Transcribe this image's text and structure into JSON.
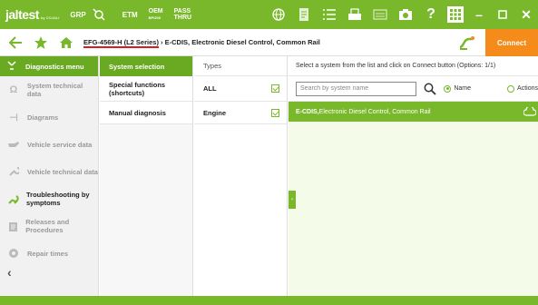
{
  "topbar": {
    "logo": "jaltest",
    "logo_sub": "by COJALI",
    "grp": "GRP",
    "etm": "ETM",
    "oem_line1": "OEM",
    "oem_line2": "BPI200",
    "pass_line1": "PASS",
    "pass_line2": "THRU"
  },
  "navbar": {
    "vehicle_id": "EFG-4569-H (L2 Series)",
    "system": " › E-CDIS, Electronic Diesel Control, Common Rail",
    "connect_label": "Connect"
  },
  "leftmenu": {
    "title": "Diagnostics menu",
    "items": [
      {
        "label": "System technical data"
      },
      {
        "label": "Diagrams"
      },
      {
        "label": "Vehicle service data"
      },
      {
        "label": "Vehicle technical data"
      },
      {
        "label": "Troubleshooting by symptoms"
      },
      {
        "label": "Releases and Procedures"
      },
      {
        "label": "Repair times"
      }
    ]
  },
  "system_selection": {
    "title": "System selection",
    "rows": [
      {
        "label": "Special functions (shortcuts)"
      },
      {
        "label": "Manual diagnosis"
      }
    ]
  },
  "types": {
    "title": "Types",
    "rows": [
      {
        "label": "ALL"
      },
      {
        "label": "Engine"
      }
    ]
  },
  "systems": {
    "info": "Select a system from the list and click on Connect button (Options: 1/1)",
    "search_placeholder": "Search by system name",
    "radio_name": "Name",
    "radio_actions": "Actions",
    "row_code": "E-CDIS,",
    "row_desc": " Electronic Diesel Control, Common Rail"
  },
  "colors": {
    "accent": "#78b82a",
    "connect": "#f48b1a",
    "underline": "#d21f1f"
  }
}
